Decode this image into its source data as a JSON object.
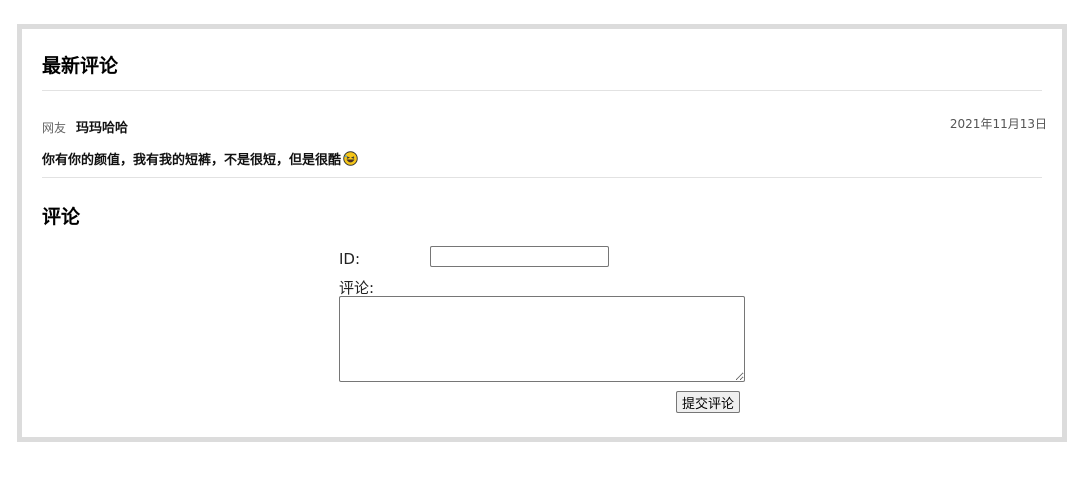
{
  "latest_comments": {
    "title": "最新评论",
    "items": [
      {
        "label": "网友",
        "author": "玛玛哈哈",
        "date": "2021年11月13日",
        "text": "你有你的颜值，我有我的短裤，不是很短，但是很酷",
        "emoji": "laughing-face-icon"
      }
    ]
  },
  "comment_form": {
    "title": "评论",
    "id_label": "ID:",
    "id_value": "",
    "comment_label": "评论:",
    "comment_value": "",
    "submit_label": "提交评论"
  },
  "colors": {
    "border": "#dcdcdc",
    "divider": "#e2e2e2",
    "emoji": "#f5c518"
  }
}
